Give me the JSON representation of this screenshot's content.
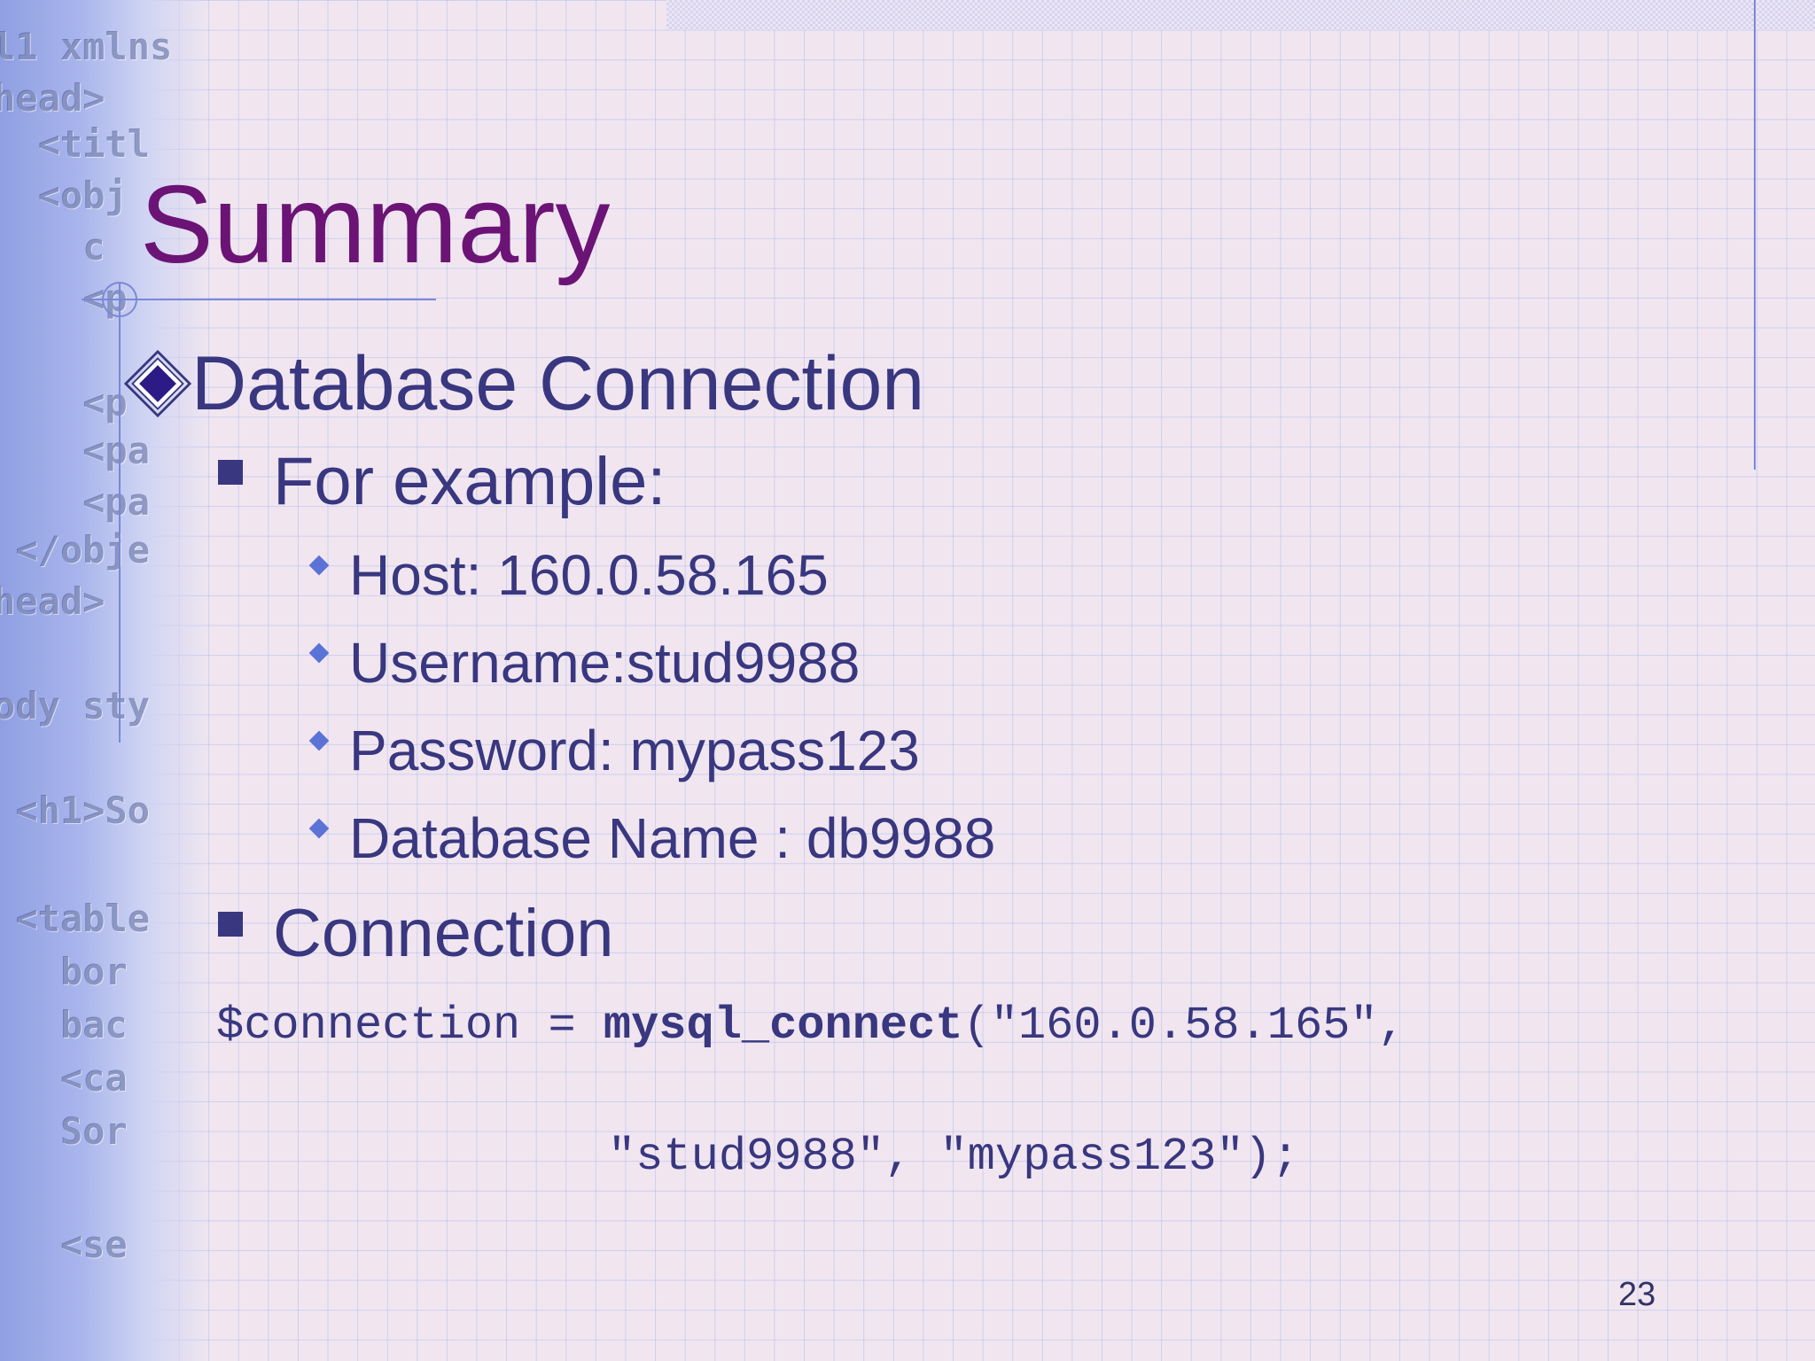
{
  "slide": {
    "title": "Summary",
    "heading": "Database Connection",
    "items": [
      {
        "label": "For example:",
        "subitems": [
          "Host: 160.0.58.165",
          "Username:stud9988",
          "Password: mypass123",
          "Database Name : db9988"
        ]
      },
      {
        "label": "Connection"
      }
    ],
    "code": {
      "var": "$connection = ",
      "func": "mysql_connect",
      "args_line1": "(\"160.0.58.165\",",
      "args_line2": "\"stud9988\", \"mypass123\");"
    },
    "page_number": "23"
  },
  "background_code": [
    "l1 xmlns",
    "head>",
    "  <titl",
    "  <obj",
    "    c",
    "    <p",
    "    <p",
    "    <pa",
    "    <pa",
    " </obje",
    "head>",
    "ody sty",
    " <h1>So",
    " <table",
    "   bor",
    "   bac",
    "   <ca",
    "   Sor",
    "   <se"
  ],
  "colors": {
    "title": "#6b1475",
    "text": "#38377f",
    "bullet_accent": "#5b72d6",
    "grid_line": "#a0b4eb",
    "background": "#f1e6f0"
  }
}
